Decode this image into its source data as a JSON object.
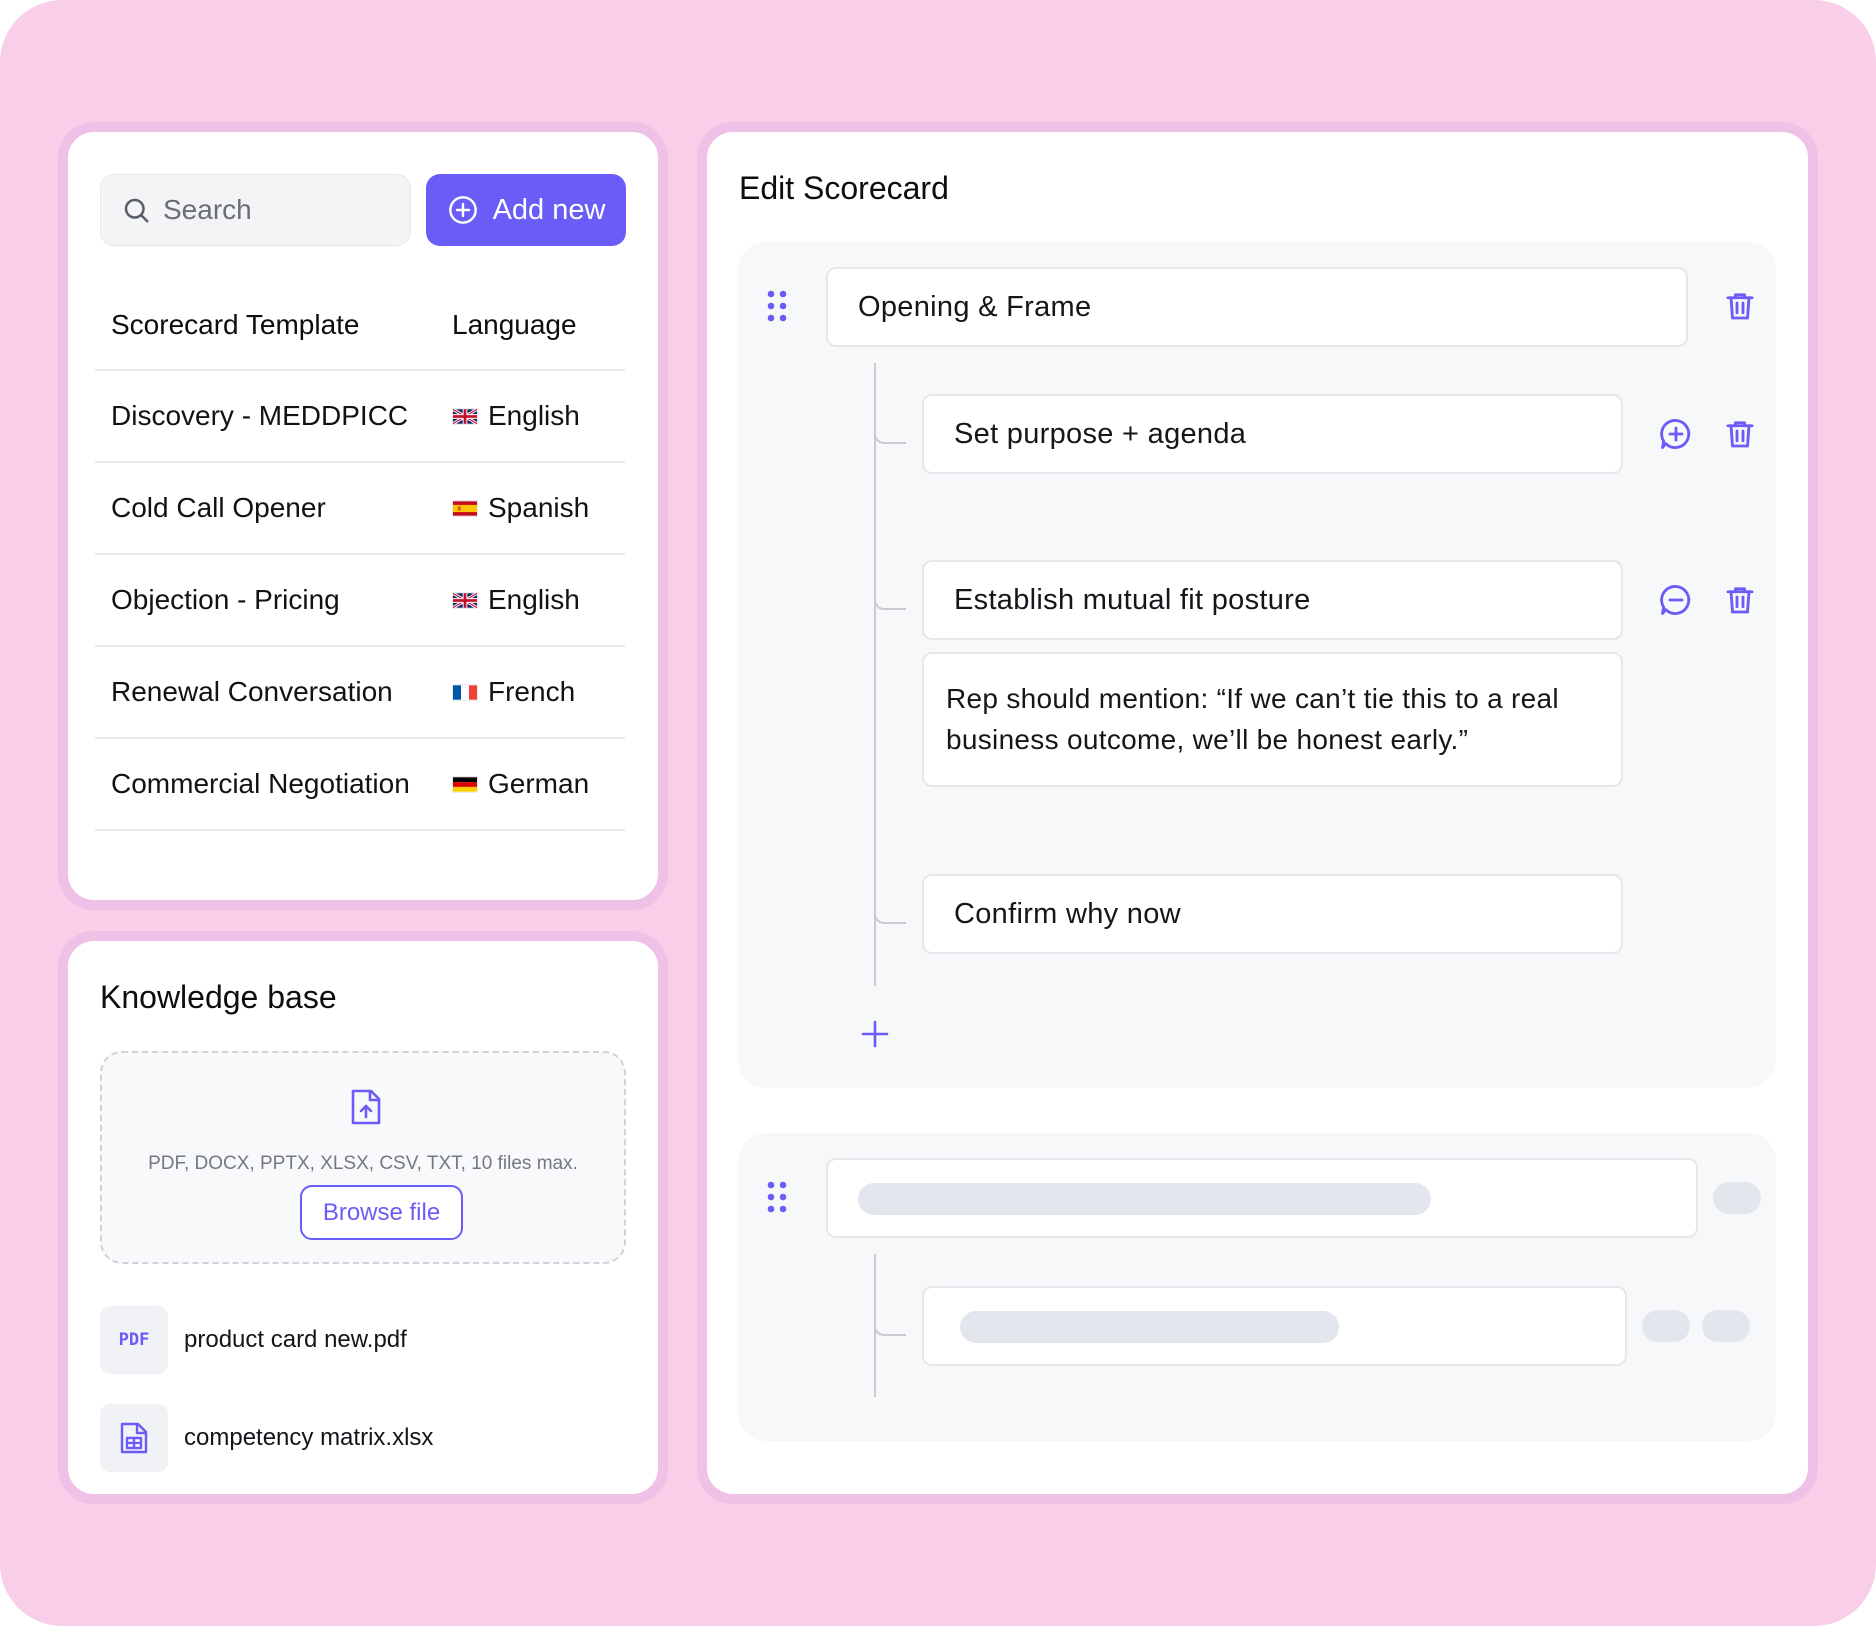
{
  "theme": {
    "accent": "#6a5cf6",
    "page_background": "#f9cee8",
    "card_border": "#efc1e6"
  },
  "templates": {
    "search": {
      "placeholder": "Search",
      "icon": "search-icon"
    },
    "add_button": {
      "label": "Add new",
      "icon": "plus-circle-icon"
    },
    "columns": {
      "template": "Scorecard Template",
      "language": "Language"
    },
    "rows": [
      {
        "name": "Discovery - MEDDPICC",
        "language": "English",
        "flag": "uk-flag-icon"
      },
      {
        "name": "Cold Call Opener",
        "language": "Spanish",
        "flag": "spain-flag-icon"
      },
      {
        "name": "Objection - Pricing",
        "language": "English",
        "flag": "uk-flag-icon"
      },
      {
        "name": "Renewal Conversation",
        "language": "French",
        "flag": "france-flag-icon"
      },
      {
        "name": "Commercial Negotiation",
        "language": "German",
        "flag": "germany-flag-icon"
      }
    ]
  },
  "knowledge_base": {
    "title": "Knowledge base",
    "upload": {
      "icon": "file-upload-icon",
      "hint": "PDF, DOCX, PPTX, XLSX, CSV, TXT, 10 files max.",
      "browse_label": "Browse file"
    },
    "files": [
      {
        "badge": "PDF",
        "name": "product card new.pdf",
        "icon": "pdf-file-icon"
      },
      {
        "name": "competency matrix.xlsx",
        "icon": "spreadsheet-file-icon"
      }
    ]
  },
  "editor": {
    "title": "Edit Scorecard",
    "section": {
      "title": "Opening & Frame",
      "items": [
        {
          "label": "Set purpose + agenda"
        },
        {
          "label": "Establish mutual fit posture",
          "note": "Rep should mention: “If we can’t tie this to a real business outcome, we’ll be honest early.”"
        },
        {
          "label": "Confirm why now"
        }
      ]
    }
  }
}
